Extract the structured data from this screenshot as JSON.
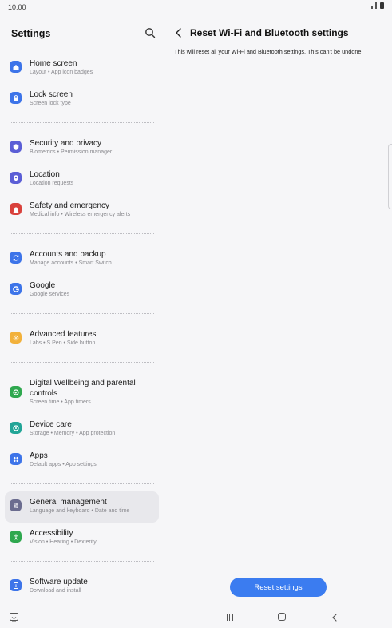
{
  "status": {
    "time": "10:00"
  },
  "left": {
    "title": "Settings",
    "items": [
      {
        "title": "Home screen",
        "subtitle": "Layout  •  App icon badges",
        "icon": "home-icon",
        "color": "#3d74e9"
      },
      {
        "title": "Lock screen",
        "subtitle": "Screen lock type",
        "icon": "lock-icon",
        "color": "#3d74e9"
      },
      {
        "title": "Security and privacy",
        "subtitle": "Biometrics  •  Permission manager",
        "icon": "shield-icon",
        "color": "#5b5ed6"
      },
      {
        "title": "Location",
        "subtitle": "Location requests",
        "icon": "location-icon",
        "color": "#5b5ed6"
      },
      {
        "title": "Safety and emergency",
        "subtitle": "Medical info  •  Wireless emergency alerts",
        "icon": "emergency-icon",
        "color": "#d9413c"
      },
      {
        "title": "Accounts and backup",
        "subtitle": "Manage accounts  •  Smart Switch",
        "icon": "sync-icon",
        "color": "#3d74e9"
      },
      {
        "title": "Google",
        "subtitle": "Google services",
        "icon": "google-icon",
        "color": "#3d74e9"
      },
      {
        "title": "Advanced features",
        "subtitle": "Labs  •  S Pen  •  Side button",
        "icon": "gear-plus-icon",
        "color": "#f2b13b"
      },
      {
        "title": "Digital Wellbeing and parental controls",
        "subtitle": "Screen time  •  App timers",
        "icon": "wellbeing-icon",
        "color": "#2fa84f"
      },
      {
        "title": "Device care",
        "subtitle": "Storage  •  Memory  •  App protection",
        "icon": "device-care-icon",
        "color": "#22a597"
      },
      {
        "title": "Apps",
        "subtitle": "Default apps  •  App settings",
        "icon": "apps-icon",
        "color": "#3d74e9"
      },
      {
        "title": "General management",
        "subtitle": "Language and keyboard  •  Date and time",
        "icon": "sliders-icon",
        "color": "#6b6c8f"
      },
      {
        "title": "Accessibility",
        "subtitle": "Vision  •  Hearing  •  Dexterity",
        "icon": "accessibility-icon",
        "color": "#2fa84f"
      },
      {
        "title": "Software update",
        "subtitle": "Download and install",
        "icon": "update-icon",
        "color": "#3d74e9"
      }
    ]
  },
  "right": {
    "title": "Reset Wi-Fi and Bluetooth settings",
    "description": "This will reset all your Wi-Fi and Bluetooth settings. This can't be undone.",
    "button_label": "Reset settings",
    "accent": "#3b7cf0"
  }
}
